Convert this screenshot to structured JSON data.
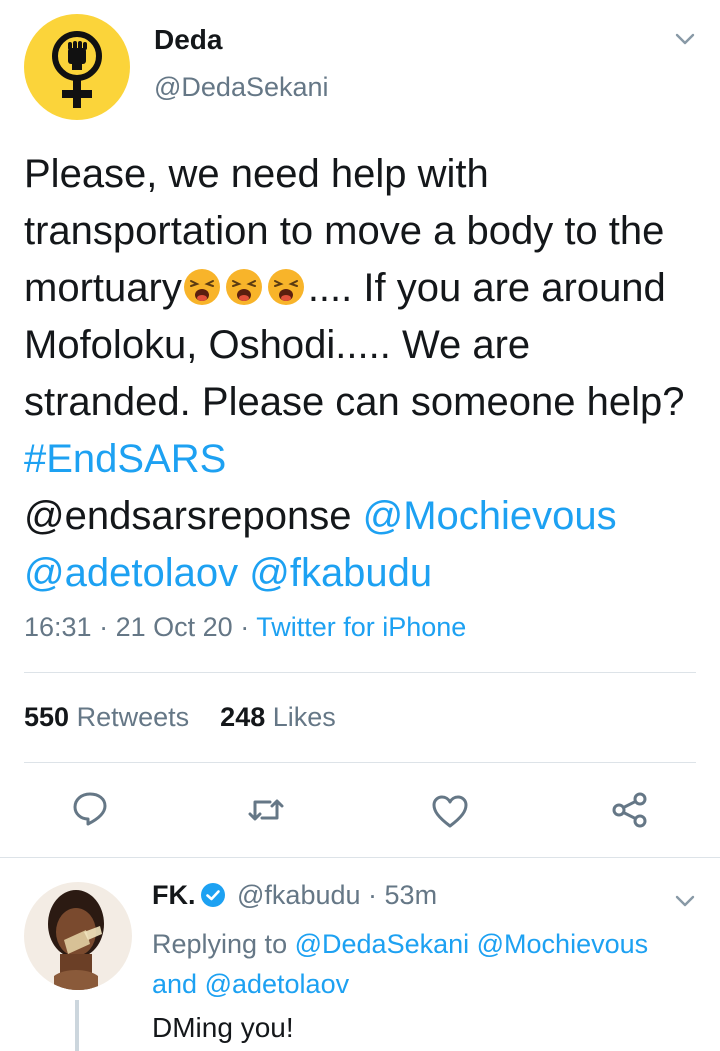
{
  "tweet": {
    "author_name": "Deda",
    "author_handle": "@DedaSekani",
    "text_parts": {
      "p1": "Please, we need help with transportation to move a body to the mortuary",
      "p2": ".... If you are around Mofoloku, Oshodi..... We are stranded. Please can someone help? ",
      "hashtag": "#EndSARS",
      "m1": "@endsarsreponse",
      "m2": "@Mochievous",
      "m3": "@adetolaov",
      "m4": "@fkabudu"
    },
    "time": "16:31",
    "date": "21 Oct 20",
    "source": "Twitter for iPhone",
    "retweets_count": "550",
    "retweets_label": "Retweets",
    "likes_count": "248",
    "likes_label": "Likes"
  },
  "reply": {
    "name": "FK.",
    "handle": "@fkabudu",
    "age": "53m",
    "replying_to_label": "Replying to",
    "replying_to_1": "@DedaSekani",
    "replying_to_2": "@Mochievous",
    "and_label": "and",
    "replying_to_3": "@adetolaov",
    "text": "DMing you!"
  },
  "icons": {
    "avatar_symbol": "raised-fist-venus-icon",
    "emoji": "tired-face-emoji",
    "actions": [
      "reply-icon",
      "retweet-icon",
      "like-icon",
      "share-icon"
    ],
    "verified": "verified-badge-icon",
    "menu": "chevron-down-icon"
  },
  "colors": {
    "link": "#1da1f2",
    "secondary_text": "#657786",
    "primary_text": "#14171a",
    "avatar_bg": "#fbd43a",
    "divider": "#dde3e8"
  }
}
